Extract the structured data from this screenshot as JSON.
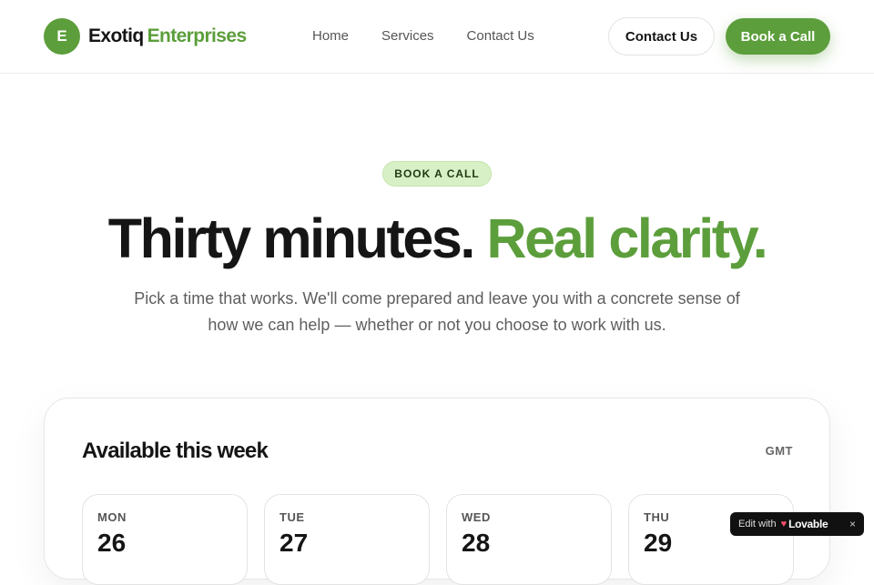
{
  "header": {
    "logo_letter": "E",
    "brand_part1": "Exotiq",
    "brand_part2": "Enterprises",
    "nav": [
      "Home",
      "Services",
      "Contact Us"
    ],
    "contact_button": "Contact Us",
    "book_button": "Book a Call"
  },
  "hero": {
    "eyebrow": "BOOK A CALL",
    "title_part1": "Thirty minutes.",
    "title_part2": "Real clarity.",
    "subtitle": "Pick a time that works. We'll come prepared and leave you with a concrete sense of how we can help — whether or not you choose to work with us."
  },
  "availability": {
    "title": "Available this week",
    "timezone": "GMT",
    "days": [
      {
        "name": "MON",
        "date": "26"
      },
      {
        "name": "TUE",
        "date": "27"
      },
      {
        "name": "WED",
        "date": "28"
      },
      {
        "name": "THU",
        "date": "29"
      }
    ]
  },
  "badge": {
    "edit_label": "Edit with",
    "brand": "Lovable",
    "close": "×"
  },
  "colors": {
    "accent": "#5c9e3b",
    "eyebrow_bg": "#d8f0c6",
    "text": "#151515"
  },
  "icons": {
    "logo": "letter-circle",
    "lovable": "heart-icon",
    "close": "close-icon"
  }
}
